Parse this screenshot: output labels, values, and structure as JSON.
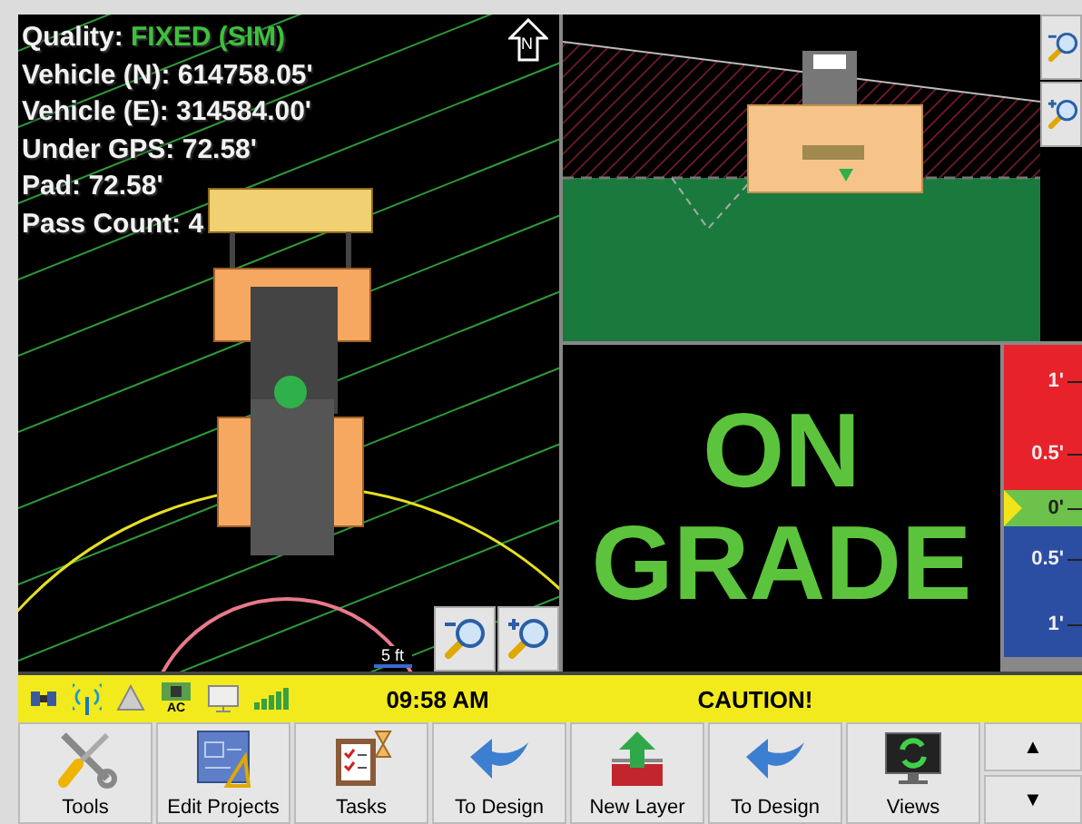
{
  "plan_view": {
    "info": [
      {
        "label": "Quality:",
        "value": "FIXED (SIM)",
        "kind": "quality"
      },
      {
        "label": "Vehicle (N):",
        "value": "614758.05'",
        "kind": "plain"
      },
      {
        "label": "Vehicle (E):",
        "value": "314584.00'",
        "kind": "plain"
      },
      {
        "label": "Under GPS:",
        "value": "72.58'",
        "kind": "plain"
      },
      {
        "label": "Pad:",
        "value": "72.58'",
        "kind": "plain"
      },
      {
        "label": "Pass Count:",
        "value": "4",
        "kind": "plain"
      }
    ],
    "north_label": "N",
    "scale_label": "5 ft"
  },
  "grade": {
    "status": "ON GRADE",
    "ticks": [
      {
        "label": "1'",
        "color": "#e8222a",
        "selected": false
      },
      {
        "label": "0.5'",
        "color": "#e8222a",
        "selected": false
      },
      {
        "label": "0'",
        "color": "#6cc24a",
        "selected": true
      },
      {
        "label": "0.5'",
        "color": "#2b4ea2",
        "selected": false
      },
      {
        "label": "1'",
        "color": "#2b4ea2",
        "selected": false
      }
    ]
  },
  "status_bar": {
    "power_label": "AC",
    "time": "09:58 AM",
    "message": "CAUTION!"
  },
  "toolbar": [
    {
      "label": "Tools",
      "kind": "tools"
    },
    {
      "label": "Edit Projects",
      "kind": "blueprint"
    },
    {
      "label": "Tasks",
      "kind": "clipboard"
    },
    {
      "label": "To Design",
      "kind": "back"
    },
    {
      "label": "New Layer",
      "kind": "layer"
    },
    {
      "label": "To Design",
      "kind": "back"
    },
    {
      "label": "Views",
      "kind": "monitor"
    }
  ],
  "scroll": {
    "up": "▲",
    "down": "▼"
  }
}
